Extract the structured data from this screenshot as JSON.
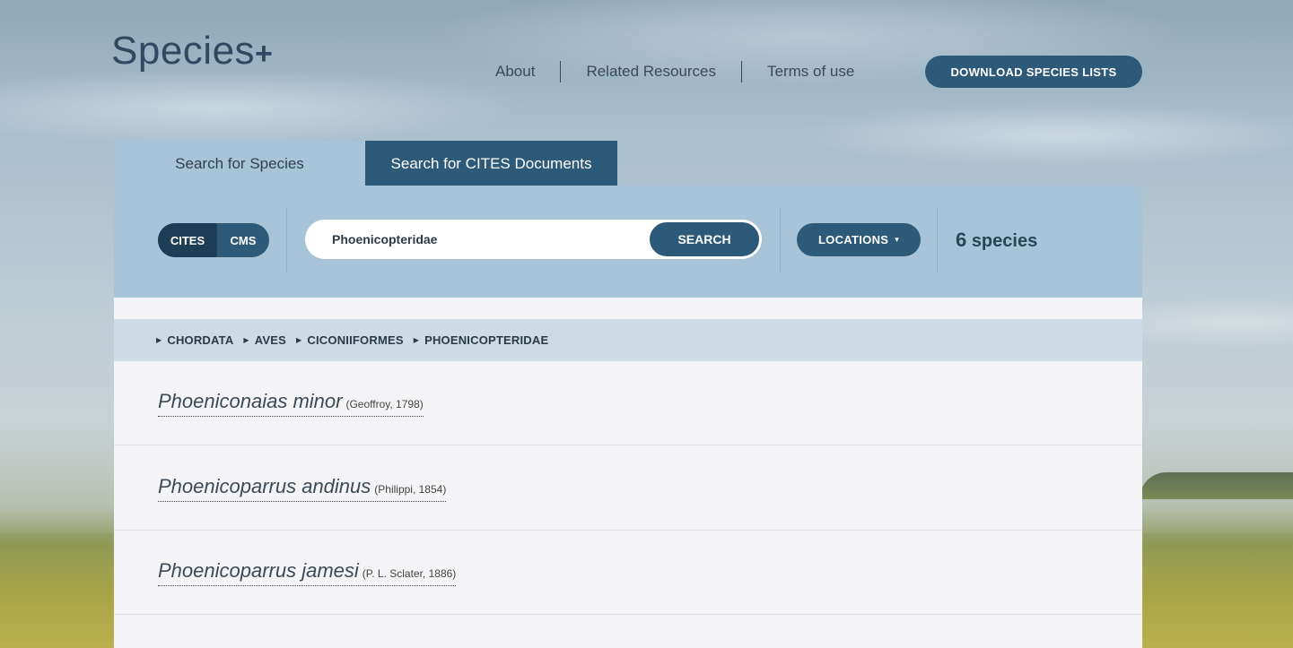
{
  "header": {
    "logo_text": "Species",
    "logo_plus": "+",
    "nav": [
      "About",
      "Related Resources",
      "Terms of use"
    ],
    "download_label": "DOWNLOAD SPECIES LISTS"
  },
  "tabs": {
    "species": "Search for Species",
    "documents": "Search for CITES Documents"
  },
  "search": {
    "toggle_cites": "CITES",
    "toggle_cms": "CMS",
    "query": "Phoenicopteridae",
    "button": "SEARCH",
    "locations_label": "LOCATIONS",
    "locations_caret": "▾",
    "count_number": "6",
    "count_label": "species"
  },
  "breadcrumb": [
    "CHORDATA",
    "AVES",
    "CICONIIFORMES",
    "PHOENICOPTERIDAE"
  ],
  "results": [
    {
      "name": "Phoeniconaias minor",
      "author": "(Geoffroy, 1798)"
    },
    {
      "name": "Phoenicoparrus andinus",
      "author": "(Philippi, 1854)"
    },
    {
      "name": "Phoenicoparrus jamesi",
      "author": "(P. L. Sclater, 1886)"
    }
  ],
  "colors": {
    "brand_dark": "#2d5a78",
    "panel": "#a7c4d8",
    "breadcrumb_bg": "#cfdbe4"
  }
}
